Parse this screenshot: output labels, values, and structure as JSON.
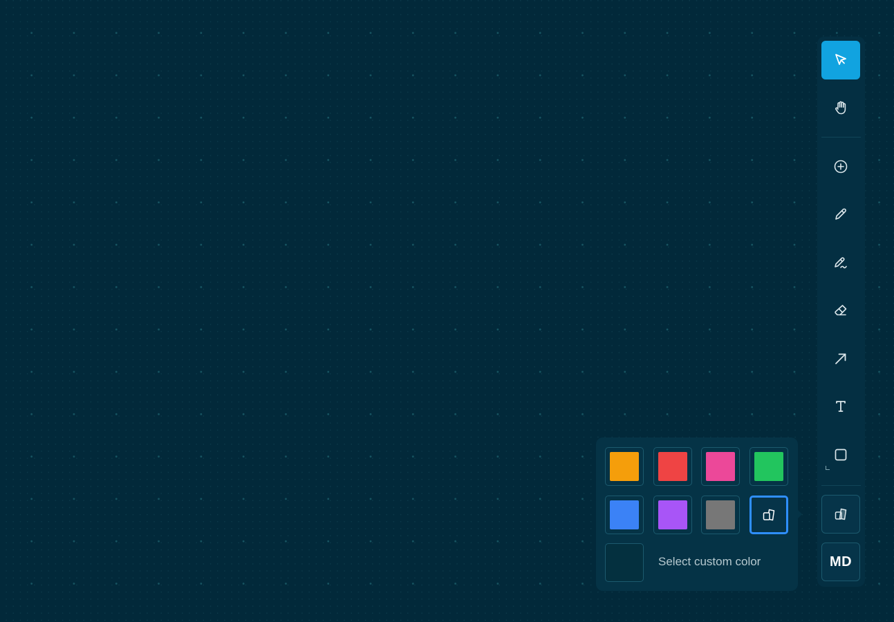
{
  "toolbar": {
    "tools": [
      {
        "name": "select",
        "icon": "cursor-icon",
        "active": true
      },
      {
        "name": "hand",
        "icon": "hand-icon",
        "active": false
      },
      {
        "name": "add",
        "icon": "plus-circle-icon",
        "active": false
      },
      {
        "name": "pencil",
        "icon": "pencil-icon",
        "active": false
      },
      {
        "name": "highlighter",
        "icon": "highlighter-icon",
        "active": false
      },
      {
        "name": "eraser",
        "icon": "eraser-icon",
        "active": false
      },
      {
        "name": "arrow",
        "icon": "arrow-icon",
        "active": false
      },
      {
        "name": "text",
        "icon": "text-icon",
        "active": false
      },
      {
        "name": "rectangle",
        "icon": "square-icon",
        "active": false
      },
      {
        "name": "color",
        "icon": "shapes-icon",
        "active": false
      }
    ],
    "size_label": "MD",
    "active_color": "#11a3e0"
  },
  "color_popup": {
    "swatches": [
      {
        "name": "orange",
        "color": "#f59e0b"
      },
      {
        "name": "red",
        "color": "#ef4444"
      },
      {
        "name": "pink",
        "color": "#ec4899"
      },
      {
        "name": "green",
        "color": "#22c55e"
      },
      {
        "name": "blue",
        "color": "#3b82f6"
      },
      {
        "name": "purple",
        "color": "#a855f7"
      },
      {
        "name": "gray",
        "color": "#777777"
      },
      {
        "name": "default",
        "icon": "shapes-icon",
        "selected": true
      }
    ],
    "custom_label": "Select custom color"
  },
  "colors": {
    "canvas_bg": "#02293a",
    "panel_bg": "#053346",
    "selected_border": "#2f8fff"
  }
}
